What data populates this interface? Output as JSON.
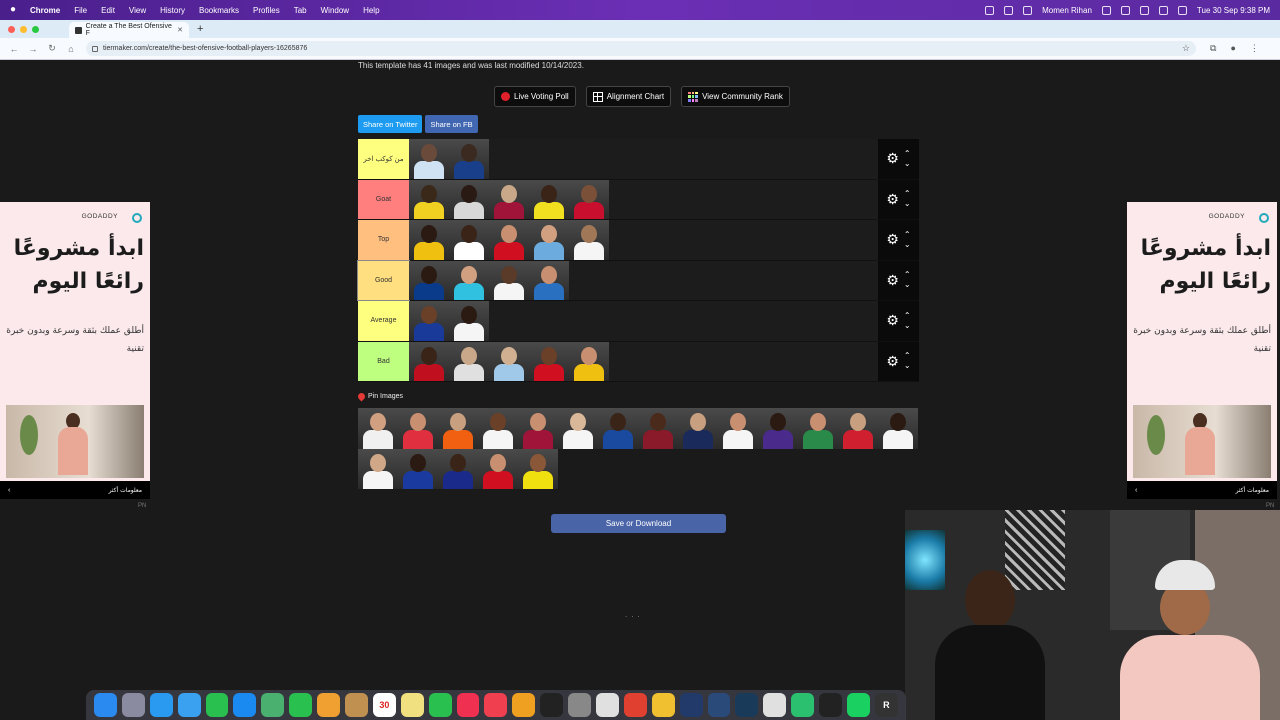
{
  "menubar": {
    "app": "Chrome",
    "items": [
      "File",
      "Edit",
      "View",
      "History",
      "Bookmarks",
      "Profiles",
      "Tab",
      "Window",
      "Help"
    ],
    "user": "Momen Rihan",
    "datetime": "Tue 30 Sep  9:38 PM"
  },
  "browser": {
    "tab_title": "Create a The Best Ofensive F",
    "url": "tiermaker.com/create/the-best-ofensive-football-players-16265876"
  },
  "page": {
    "info": "This template has 41 images and was last modified 10/14/2023.",
    "buttons": {
      "live_voting": "Live Voting Poll",
      "alignment": "Alignment Chart",
      "community": "View Community Rank"
    },
    "share": {
      "twitter": "Share on Twitter",
      "facebook": "Share on FB"
    },
    "tiers": [
      {
        "label": "من كوكب اخر",
        "color": "#ffff7f",
        "players": [
          [
            "#cfe2f3",
            "#6a4a3a"
          ],
          [
            "#1a3f8a",
            "#3a2a20"
          ]
        ]
      },
      {
        "label": "Goat",
        "color": "#ff7f7f",
        "players": [
          [
            "#f0d020",
            "#3a2818"
          ],
          [
            "#d8d8d8",
            "#2a1a14"
          ],
          [
            "#a0143a",
            "#c8a888"
          ],
          [
            "#f0e020",
            "#3a2418"
          ],
          [
            "#c8102e",
            "#7a5038"
          ]
        ]
      },
      {
        "label": "Top",
        "color": "#ffbf7f",
        "players": [
          [
            "#f0c010",
            "#2a1a12"
          ],
          [
            "#ffffff",
            "#3a2418"
          ],
          [
            "#d01020",
            "#c89070"
          ],
          [
            "#6cabdd",
            "#d0a080"
          ],
          [
            "#f5f5f5",
            "#a07858"
          ]
        ]
      },
      {
        "label": "Good",
        "color": "#ffdf7f",
        "players": [
          [
            "#0a3a8a",
            "#2a1a12"
          ],
          [
            "#30c0e0",
            "#d0a080"
          ],
          [
            "#f5f5f5",
            "#5a3a28"
          ],
          [
            "#2a70c0",
            "#c89070"
          ]
        ]
      },
      {
        "label": "Average",
        "color": "#ffff7f",
        "players": [
          [
            "#1a3a9a",
            "#6a4028"
          ],
          [
            "#f5f5f5",
            "#2a1a12"
          ]
        ]
      },
      {
        "label": "Bad",
        "color": "#bfff7f",
        "players": [
          [
            "#c01020",
            "#3a2418"
          ],
          [
            "#e0e0e0",
            "#c8a888"
          ],
          [
            "#a0c8e8",
            "#d0b090"
          ],
          [
            "#d01020",
            "#6a4028"
          ],
          [
            "#f0c010",
            "#c89070"
          ]
        ]
      }
    ],
    "pin_label": "Pin Images",
    "pool": [
      [
        "#f0f0f0",
        "#d0a080"
      ],
      [
        "#e03040",
        "#c89070"
      ],
      [
        "#f06010",
        "#c8a080"
      ],
      [
        "#f5f5f5",
        "#6a4028"
      ],
      [
        "#a0143a",
        "#c89070"
      ],
      [
        "#f5f5f5",
        "#d8b898"
      ],
      [
        "#1a4aa0",
        "#3a2418"
      ],
      [
        "#8a1a2a",
        "#4a2a1a"
      ],
      [
        "#1a2a5a",
        "#c8a080"
      ],
      [
        "#f5f5f5",
        "#c89070"
      ],
      [
        "#4a2a8a",
        "#2a1a12"
      ],
      [
        "#2a8a4a",
        "#c89070"
      ],
      [
        "#d02030",
        "#c8a080"
      ],
      [
        "#f5f5f5",
        "#2a1a12"
      ],
      [
        "#f5f5f5",
        "#d0a888"
      ],
      [
        "#1a3aa0",
        "#2a1a12"
      ],
      [
        "#1a2a8a",
        "#3a2418"
      ],
      [
        "#d01020",
        "#c89070"
      ],
      [
        "#f0e010",
        "#8a5838"
      ]
    ],
    "save": "Save or Download",
    "loading": "..."
  },
  "ad": {
    "brand": "GODADDY",
    "headline": "ابدأ مشروعًا رائعًا اليوم",
    "body": "أطلق عملك بثقة وسرعة وبدون خبرة تقنية",
    "more": "معلومات أكثر",
    "pn": "PN"
  },
  "dock": {
    "apps": [
      {
        "name": "finder",
        "color": "#2a8af0",
        "glyph": ""
      },
      {
        "name": "launchpad",
        "color": "#8a8aa0",
        "glyph": ""
      },
      {
        "name": "safari",
        "color": "#2a9af0",
        "glyph": ""
      },
      {
        "name": "mail",
        "color": "#3aa0f0",
        "glyph": ""
      },
      {
        "name": "facetime",
        "color": "#2ac050",
        "glyph": ""
      },
      {
        "name": "appstore",
        "color": "#1a8af0",
        "glyph": ""
      },
      {
        "name": "maps",
        "color": "#4ab070",
        "glyph": ""
      },
      {
        "name": "messages",
        "color": "#2ac050",
        "glyph": ""
      },
      {
        "name": "photos",
        "color": "#f0a030",
        "glyph": ""
      },
      {
        "name": "notes-app",
        "color": "#c09050",
        "glyph": ""
      },
      {
        "name": "calendar",
        "color": "#ffffff",
        "glyph": "30"
      },
      {
        "name": "notes",
        "color": "#f0e080",
        "glyph": ""
      },
      {
        "name": "whatsapp",
        "color": "#2ac050",
        "glyph": ""
      },
      {
        "name": "music",
        "color": "#f03050",
        "glyph": ""
      },
      {
        "name": "news",
        "color": "#f04050",
        "glyph": ""
      },
      {
        "name": "pages",
        "color": "#f0a020",
        "glyph": ""
      },
      {
        "name": "terminal",
        "color": "#222222",
        "glyph": ""
      },
      {
        "name": "settings",
        "color": "#888888",
        "glyph": ""
      },
      {
        "name": "preview",
        "color": "#e0e0e0",
        "glyph": ""
      },
      {
        "name": "chrome",
        "color": "#e04030",
        "glyph": ""
      },
      {
        "name": "files",
        "color": "#f0c030",
        "glyph": ""
      },
      {
        "name": "audio",
        "color": "#223a6a",
        "glyph": ""
      },
      {
        "name": "audio2",
        "color": "#2a4a7a",
        "glyph": ""
      },
      {
        "name": "audio3",
        "color": "#1a3a5a",
        "glyph": ""
      },
      {
        "name": "globe",
        "color": "#e0e0e0",
        "glyph": ""
      },
      {
        "name": "android",
        "color": "#2ac070",
        "glyph": ""
      },
      {
        "name": "obs",
        "color": "#222222",
        "glyph": ""
      },
      {
        "name": "spotify",
        "color": "#1ad060",
        "glyph": ""
      },
      {
        "name": "rstudio",
        "color": "#333333",
        "glyph": "R"
      }
    ]
  }
}
